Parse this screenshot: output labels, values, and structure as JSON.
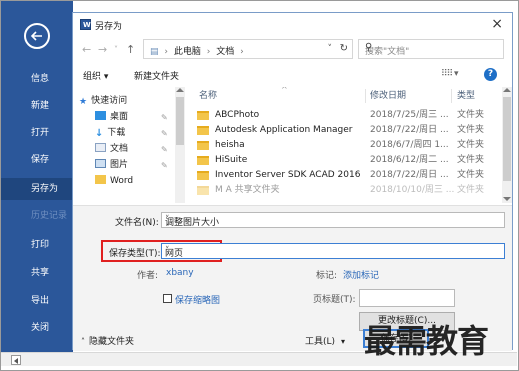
{
  "backstage": {
    "items": [
      {
        "label": "信息"
      },
      {
        "label": "新建"
      },
      {
        "label": "打开"
      },
      {
        "label": "保存"
      },
      {
        "label": "另存为"
      },
      {
        "label": "历史记录"
      },
      {
        "label": "打印"
      },
      {
        "label": "共享"
      },
      {
        "label": "导出"
      },
      {
        "label": "关闭"
      }
    ],
    "accent_color": "#2b579a"
  },
  "dialog": {
    "title": "另存为",
    "app_icon": "W",
    "close_icon": "×",
    "address": {
      "crumbs": [
        "此电脑",
        "文档"
      ],
      "search_placeholder": "搜索\"文档\""
    },
    "toolbar": {
      "organize": "组织 ▾",
      "new_folder": "新建文件夹"
    },
    "tree": [
      {
        "label": "快速访问",
        "icon": "star-icon"
      },
      {
        "label": "桌面",
        "icon": "desktop-icon"
      },
      {
        "label": "下载",
        "icon": "download-icon"
      },
      {
        "label": "文档",
        "icon": "documents-icon"
      },
      {
        "label": "图片",
        "icon": "pictures-icon"
      },
      {
        "label": "Word",
        "icon": "folder-icon"
      }
    ],
    "columns": {
      "name": "名称",
      "date": "修改日期",
      "type": "类型"
    },
    "files": [
      {
        "name": "ABCPhoto",
        "date": "2018/7/25/周三 ...",
        "type": "文件夹"
      },
      {
        "name": "Autodesk Application Manager",
        "date": "2018/7/22/周日 ...",
        "type": "文件夹"
      },
      {
        "name": "heisha",
        "date": "2018/6/7/周四 1...",
        "type": "文件夹"
      },
      {
        "name": "HiSuite",
        "date": "2018/6/12/周二 ...",
        "type": "文件夹"
      },
      {
        "name": "Inventor Server SDK ACAD 2016",
        "date": "2018/7/22/周日 ...",
        "type": "文件夹"
      },
      {
        "name": "M A   共享文件夹",
        "date": "2018/10/10/周三 ...",
        "type": "文件夹"
      }
    ],
    "form": {
      "filename_label": "文件名(N):",
      "filename_value": "调整图片大小",
      "filetype_label": "保存类型(T):",
      "filetype_value": "网页",
      "author_label": "作者:",
      "author_value": "xbany",
      "tags_label": "标记:",
      "tags_value": "添加标记",
      "thumbnail_label": "保存缩略图",
      "page_title_label": "页标题(T):",
      "change_title_button": "更改标题(C)...",
      "hide_folders": "隐藏文件夹",
      "tools": "工具(L)",
      "save_button": "保存(S)"
    }
  },
  "watermark": "最需教育"
}
